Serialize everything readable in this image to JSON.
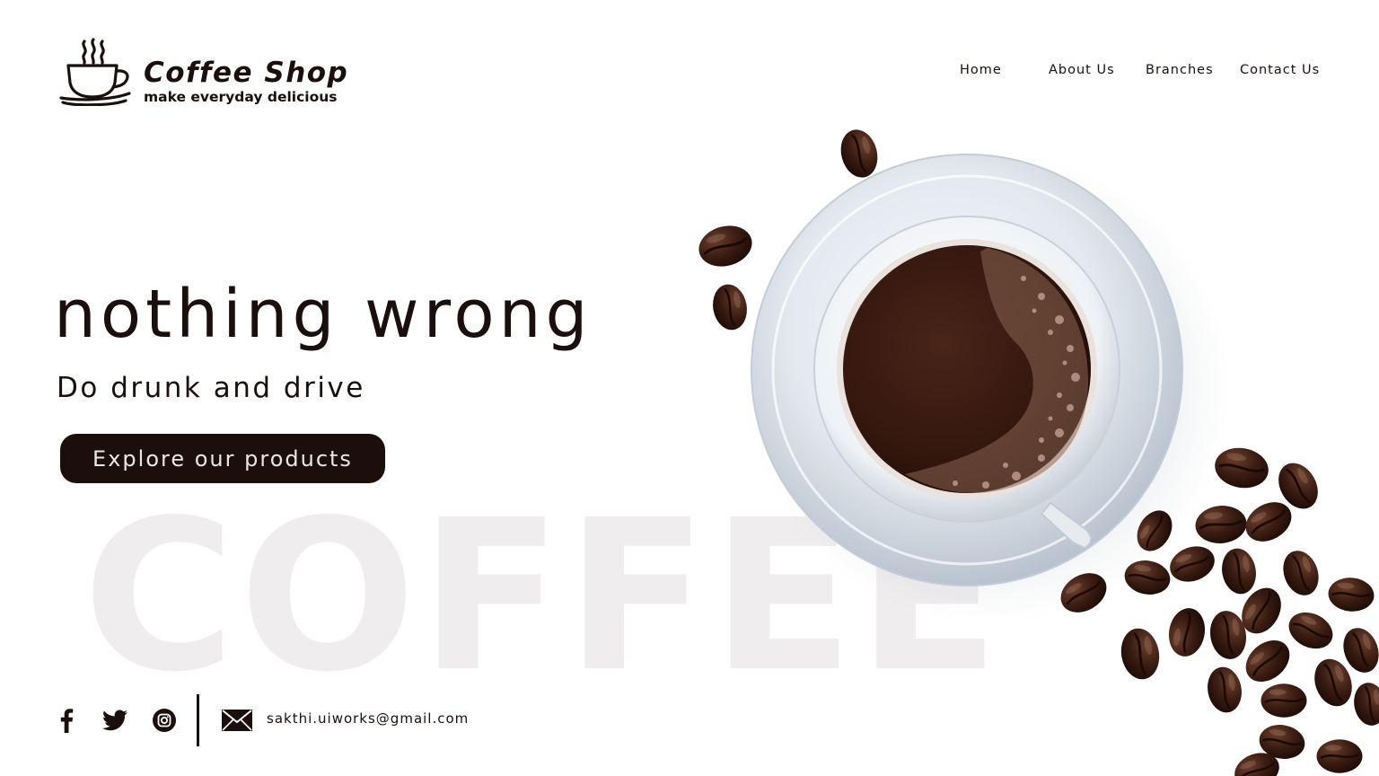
{
  "brand": {
    "title": "Coffee Shop",
    "tagline": "make everyday delicious",
    "logo_icon": "coffee-cup-icon"
  },
  "nav": {
    "items": [
      {
        "label": "Home"
      },
      {
        "label": "About Us"
      },
      {
        "label": "Branches"
      },
      {
        "label": "Contact Us"
      }
    ]
  },
  "hero": {
    "headline": "nothing wrong",
    "subheadline": "Do drunk and drive",
    "cta_label": "Explore our products",
    "watermark": "COFFEE",
    "image": "coffee-cup-with-beans"
  },
  "footer": {
    "social": [
      {
        "icon": "facebook-icon"
      },
      {
        "icon": "twitter-icon"
      },
      {
        "icon": "instagram-icon"
      }
    ],
    "mail_icon": "mail-icon",
    "email": "sakthi.uiworks@gmail.com"
  },
  "colors": {
    "primary": "#1c0f0b",
    "background": "#ffffff",
    "watermark": "#efedee",
    "button_text": "#ece6e3"
  }
}
